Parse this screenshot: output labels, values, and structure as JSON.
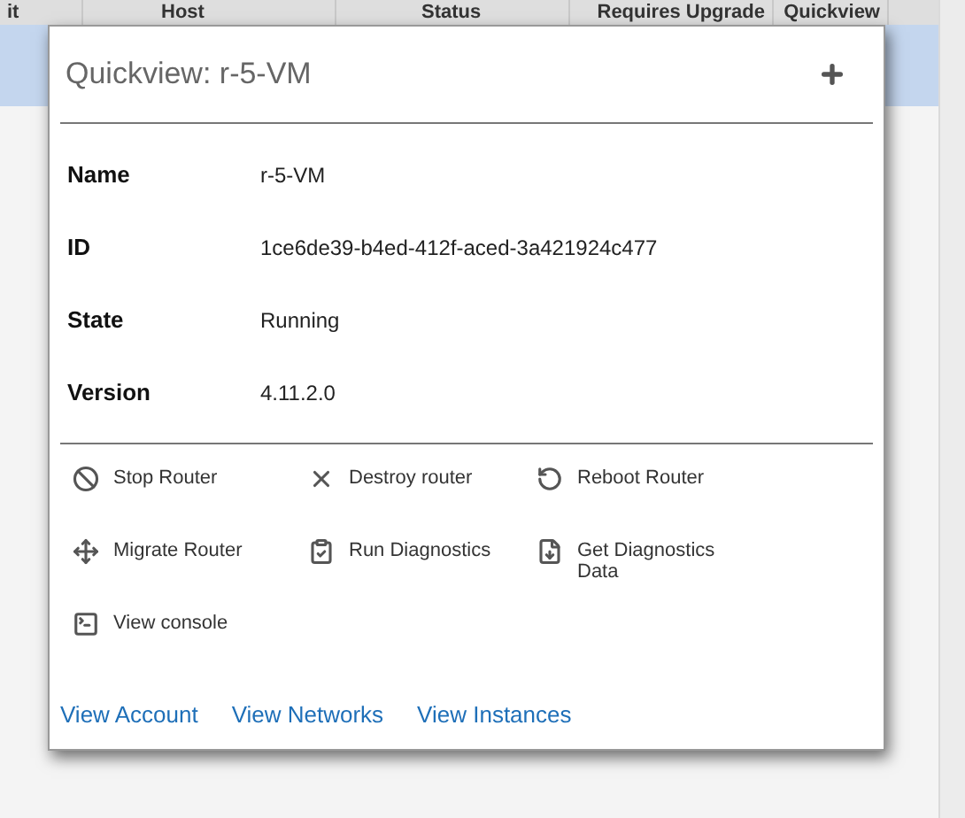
{
  "table": {
    "columns": [
      "it",
      "Host",
      "Status",
      "Requires Upgrade",
      "Quickview"
    ],
    "rows": [
      {
        "selected": true
      }
    ]
  },
  "quickview": {
    "title": "Quickview: r-5-VM",
    "details": [
      {
        "label": "Name",
        "value": "r-5-VM"
      },
      {
        "label": "ID",
        "value": "1ce6de39-b4ed-412f-aced-3a421924c477"
      },
      {
        "label": "State",
        "value": "Running"
      },
      {
        "label": "Version",
        "value": "4.11.2.0"
      }
    ],
    "actions": [
      {
        "kind": "stop",
        "label": "Stop Router"
      },
      {
        "kind": "destroy",
        "label": "Destroy router"
      },
      {
        "kind": "reboot",
        "label": "Reboot Router"
      },
      {
        "kind": "migrate",
        "label": "Migrate Router"
      },
      {
        "kind": "diagnostics",
        "label": "Run Diagnostics"
      },
      {
        "kind": "download",
        "label": "Get Diagnostics Data"
      },
      {
        "kind": "console",
        "label": "View console"
      }
    ],
    "links": [
      "View Account",
      "View Networks",
      "View Instances"
    ]
  }
}
